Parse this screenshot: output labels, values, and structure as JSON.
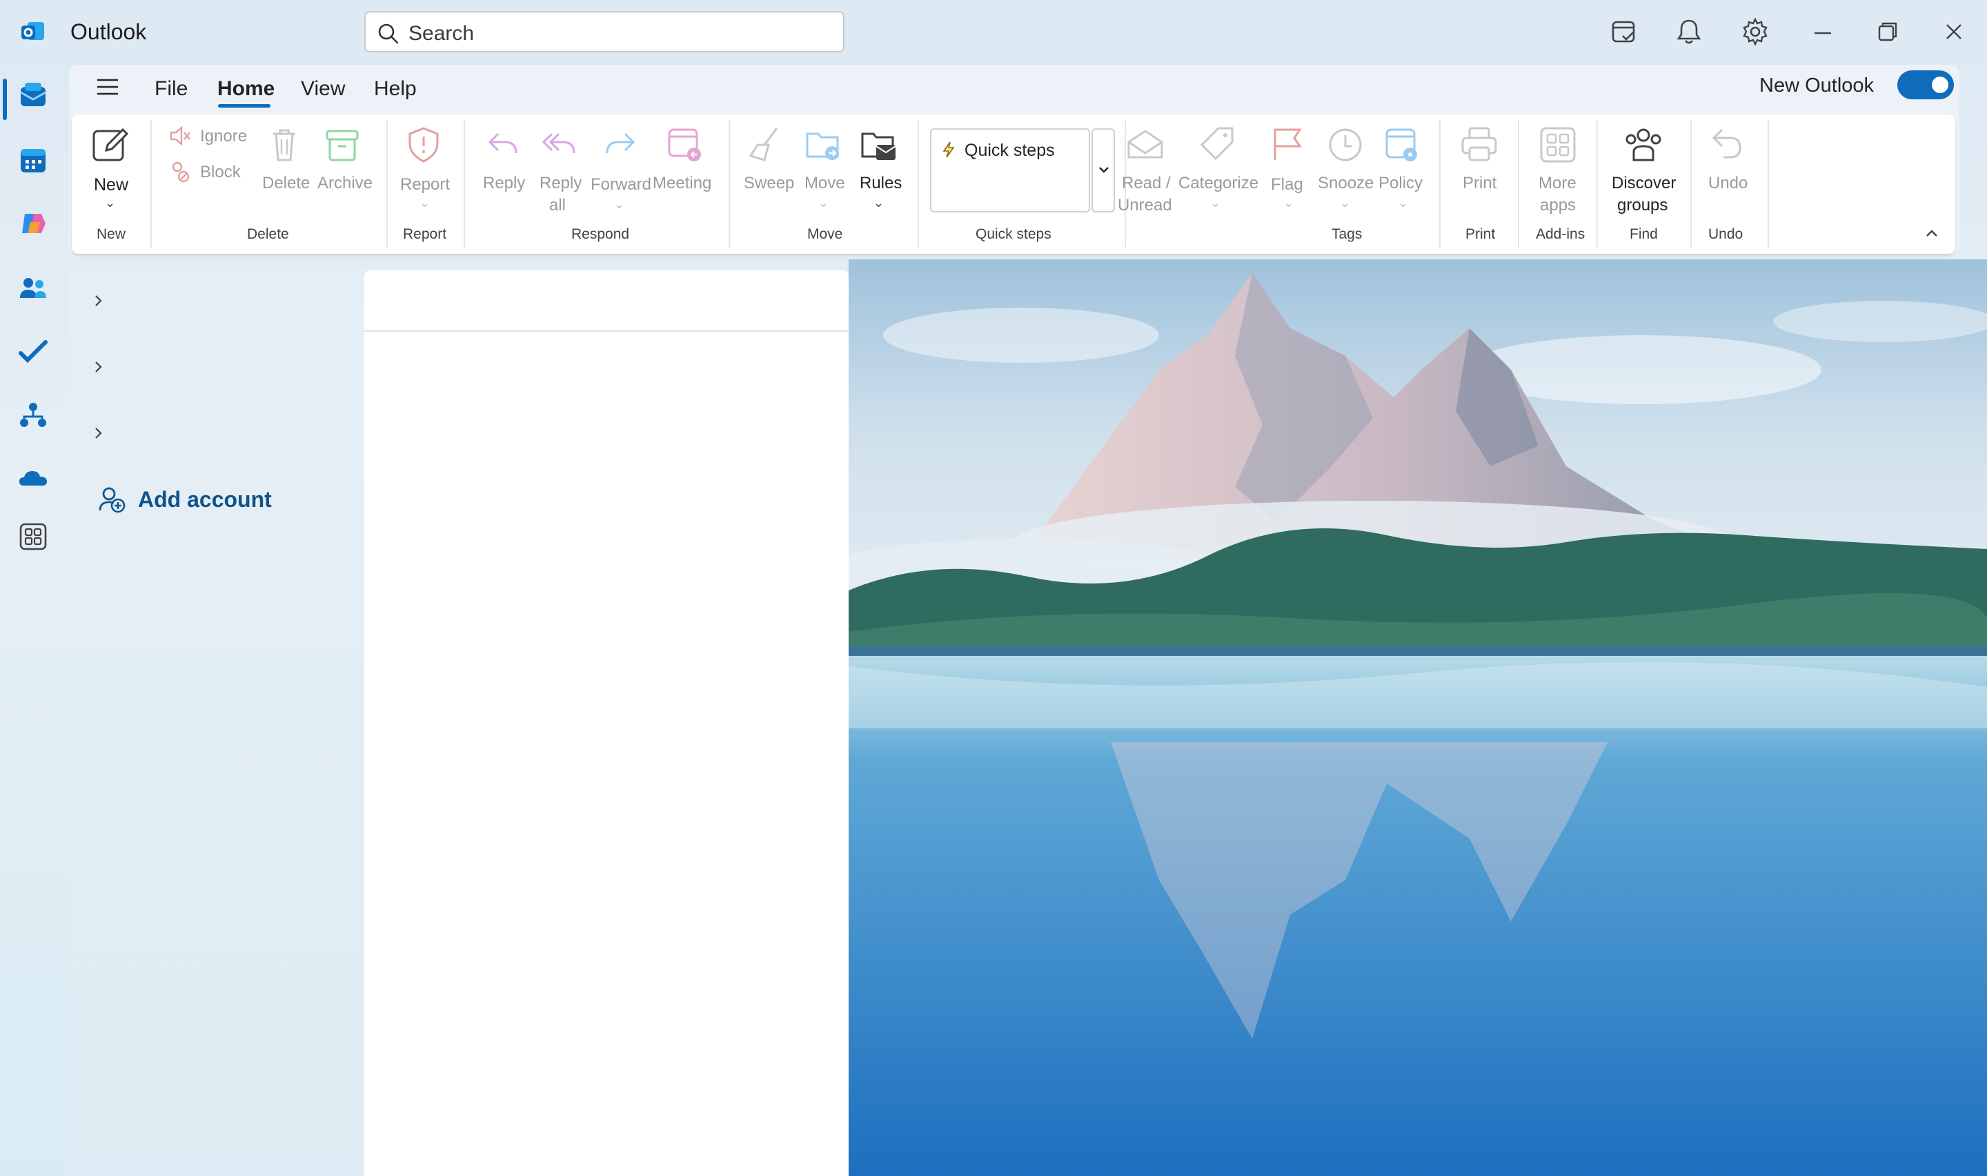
{
  "app": {
    "title": "Outlook"
  },
  "search": {
    "placeholder": "Search"
  },
  "titlebar_icons": [
    "my-day-icon",
    "bell-icon",
    "gear-icon",
    "minimize-icon",
    "restore-icon",
    "close-icon"
  ],
  "rail": {
    "items": [
      "mail-icon",
      "calendar-icon",
      "copilot-icon",
      "people-icon",
      "todo-icon",
      "org-explorer-icon",
      "onedrive-icon",
      "more-apps-icon"
    ]
  },
  "menu": {
    "tabs": [
      "File",
      "Home",
      "View",
      "Help"
    ],
    "active": "Home"
  },
  "new_outlook": {
    "label": "New Outlook",
    "enabled": true
  },
  "ribbon": {
    "new": {
      "label": "New",
      "group": "New"
    },
    "delete_group": {
      "ignore": "Ignore",
      "block": "Block",
      "delete": "Delete",
      "archive": "Archive",
      "group": "Delete"
    },
    "report": {
      "label": "Report",
      "group": "Report"
    },
    "respond": {
      "reply": "Reply",
      "reply_all_1": "Reply",
      "reply_all_2": "all",
      "forward": "Forward",
      "meeting": "Meeting",
      "group": "Respond"
    },
    "move": {
      "sweep": "Sweep",
      "move": "Move",
      "rules": "Rules",
      "group": "Move"
    },
    "quick_steps": {
      "label": "Quick steps",
      "group": "Quick steps"
    },
    "tags": {
      "read_1": "Read /",
      "read_2": "Unread",
      "categorize": "Categorize",
      "flag": "Flag",
      "snooze": "Snooze",
      "policy": "Policy",
      "group": "Tags"
    },
    "print": {
      "label": "Print",
      "group": "Print"
    },
    "addins": {
      "label_1": "More",
      "label_2": "apps",
      "group": "Add-ins"
    },
    "find": {
      "label_1": "Discover",
      "label_2": "groups",
      "group": "Find"
    },
    "undo": {
      "label": "Undo",
      "group": "Undo"
    }
  },
  "folder_pane": {
    "add_account": "Add account"
  },
  "colors": {
    "accent": "#0f6cbd",
    "link": "#0f548c"
  }
}
